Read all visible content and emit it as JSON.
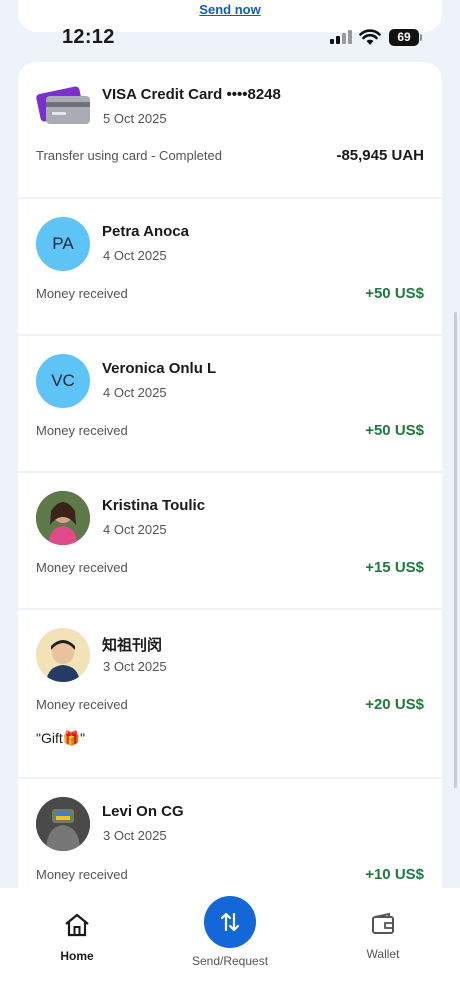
{
  "banner": {
    "send_now_label": "Send now"
  },
  "status_bar": {
    "time": "12:12",
    "battery": "69"
  },
  "transactions": [
    {
      "name": "VISA Credit Card ••••8248",
      "date": "5 Oct 2025",
      "description": "Transfer using card - Completed",
      "amount": "-85,945 UAH",
      "avatar_type": "card-icon"
    },
    {
      "name": "Petra Anoca",
      "date": "4 Oct 2025",
      "description": "Money received",
      "amount": "+50 US$",
      "initials": "PA",
      "avatar_type": "initials"
    },
    {
      "name": "Veronica Onlu L",
      "date": "4 Oct 2025",
      "description": "Money received",
      "amount": "+50 US$",
      "initials": "VC",
      "avatar_type": "initials"
    },
    {
      "name": "Kristina Toulic",
      "date": "4 Oct 2025",
      "description": "Money received",
      "amount": "+15 US$",
      "avatar_type": "photo"
    },
    {
      "name": "知祖刊闵",
      "date": "3 Oct 2025",
      "description": "Money received",
      "amount": "+20 US$",
      "note": "\"Gift🎁\"",
      "avatar_type": "photo"
    },
    {
      "name": "Levi On CG",
      "date": "3 Oct 2025",
      "description": "Money received",
      "amount": "+10 US$",
      "avatar_type": "photo"
    }
  ],
  "nav": {
    "home_label": "Home",
    "send_request_label": "Send/Request",
    "wallet_label": "Wallet"
  },
  "colors": {
    "accent": "#1467d8",
    "positive": "#1f7a3e",
    "initials_bg": "#5ec4f5",
    "background": "#eef2f9"
  }
}
